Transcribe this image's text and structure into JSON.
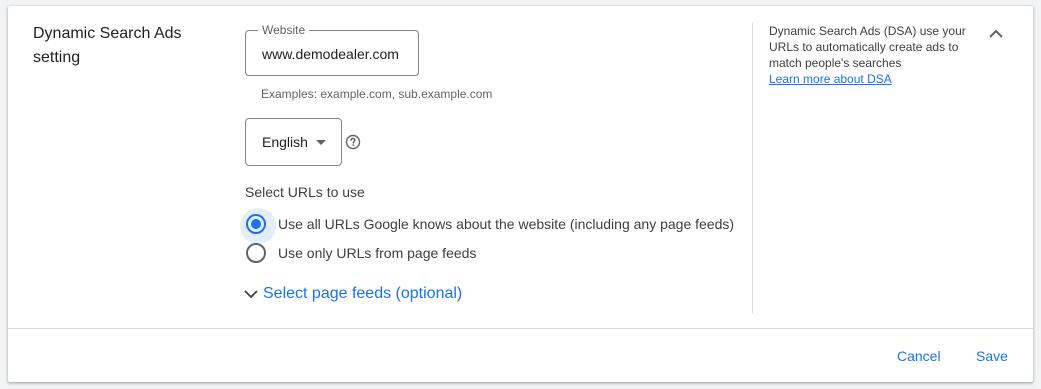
{
  "section": {
    "title": "Dynamic Search Ads setting"
  },
  "website": {
    "label": "Website",
    "value": "www.demodealer.com",
    "hint": "Examples: example.com, sub.example.com"
  },
  "language": {
    "selected": "English",
    "help_icon": "help-circle-icon"
  },
  "urls": {
    "label": "Select URLs to use",
    "options": [
      {
        "label": "Use all URLs Google knows about the website (including any page feeds)",
        "checked": true
      },
      {
        "label": "Use only URLs from page feeds",
        "checked": false
      }
    ]
  },
  "page_feeds": {
    "label": "Select page feeds (optional)",
    "icon": "chevron-down-icon"
  },
  "info": {
    "text": "Dynamic Search Ads (DSA) use your URLs to automatically create ads to match people's searches",
    "link": "Learn more about DSA"
  },
  "footer": {
    "cancel": "Cancel",
    "save": "Save"
  },
  "colors": {
    "accent": "#1a73e8",
    "text": "#202124",
    "border": "#80868b",
    "divider": "#dadce0"
  }
}
